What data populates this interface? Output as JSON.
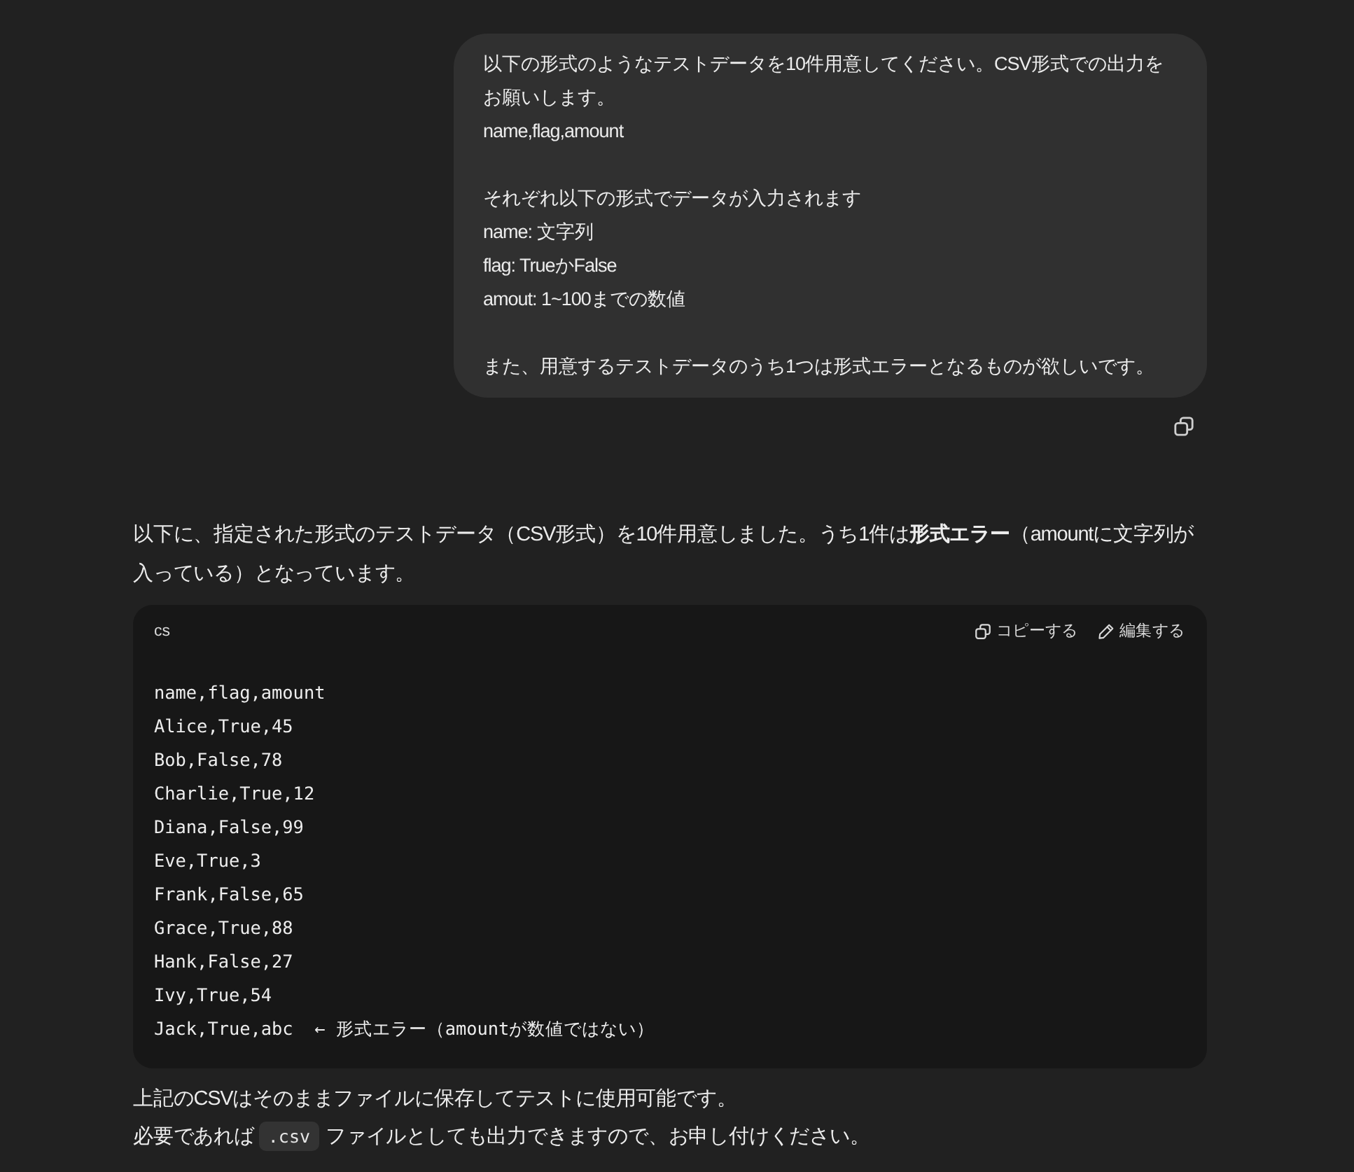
{
  "user_message": {
    "paragraphs": [
      [
        "以下の形式のようなテストデータを10件用意してください。CSV形式での出力をお願いします。",
        "name,flag,amount"
      ],
      [
        "それぞれ以下の形式でデータが入力されます",
        "name: 文字列",
        "flag: TrueかFalse",
        "amout: 1~100までの数値"
      ],
      [
        "また、用意するテストデータのうち1つは形式エラーとなるものが欲しいです。"
      ]
    ]
  },
  "assistant_message": {
    "intro": "以下に、指定された形式のテストデータ（CSV形式）を10件用意しました。うち1件は**形式エラー**（amountに文字列が入っている）となっています。",
    "code_block": {
      "language": "cs",
      "actions": [
        {
          "kind": "copy",
          "label": "コピーする"
        },
        {
          "kind": "edit",
          "label": "編集する"
        }
      ],
      "lines": [
        "name,flag,amount",
        "Alice,True,45",
        "Bob,False,78",
        "Charlie,True,12",
        "Diana,False,99",
        "Eve,True,3",
        "Frank,False,65",
        "Grace,True,88",
        "Hank,False,27",
        "Ivy,True,54",
        "Jack,True,abc  ← 形式エラー（amountが数値ではない）"
      ]
    },
    "closing": [
      {
        "kind": "text",
        "text": "上記のCSVはそのままファイルに保存してテストに使用可能です。"
      },
      {
        "kind": "with_code",
        "before": "必要であれば",
        "code": ".csv",
        "after": "ファイルとしても出力できますので、お申し付けください。"
      }
    ]
  }
}
